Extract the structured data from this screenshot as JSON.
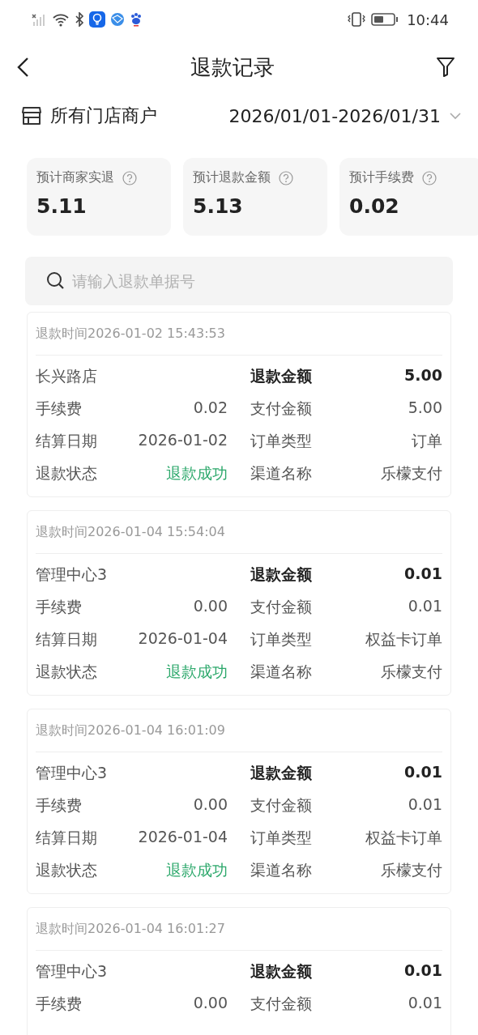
{
  "status_bar": {
    "time": "10:44"
  },
  "header": {
    "title": "退款记录"
  },
  "filter": {
    "store": "所有门店商户",
    "date_range": "2026/01/01-2026/01/31"
  },
  "stats": [
    {
      "label": "预计商家实退",
      "value": "5.11"
    },
    {
      "label": "预计退款金额",
      "value": "5.13"
    },
    {
      "label": "预计手续费",
      "value": "0.02"
    }
  ],
  "search": {
    "placeholder": "请输入退款单据号"
  },
  "records": [
    {
      "time": "退款时间2026-01-02 15:43:53",
      "rows": [
        {
          "kind": "head",
          "left_label": "长兴路店",
          "right_label": "退款金额",
          "right_value": "5.00"
        },
        {
          "kind": "plain",
          "left_label": "手续费",
          "left_value": "0.02",
          "right_label": "支付金额",
          "right_value": "5.00"
        },
        {
          "kind": "plain",
          "left_label": "结算日期",
          "left_value": "2026-01-02",
          "right_label": "订单类型",
          "right_value": "订单"
        },
        {
          "kind": "status",
          "left_label": "退款状态",
          "left_value": "退款成功",
          "right_label": "渠道名称",
          "right_value": "乐檬支付"
        }
      ]
    },
    {
      "time": "退款时间2026-01-04 15:54:04",
      "rows": [
        {
          "kind": "head",
          "left_label": "管理中心3",
          "right_label": "退款金额",
          "right_value": "0.01"
        },
        {
          "kind": "plain",
          "left_label": "手续费",
          "left_value": "0.00",
          "right_label": "支付金额",
          "right_value": "0.01"
        },
        {
          "kind": "plain",
          "left_label": "结算日期",
          "left_value": "2026-01-04",
          "right_label": "订单类型",
          "right_value": "权益卡订单"
        },
        {
          "kind": "status",
          "left_label": "退款状态",
          "left_value": "退款成功",
          "right_label": "渠道名称",
          "right_value": "乐檬支付"
        }
      ]
    },
    {
      "time": "退款时间2026-01-04 16:01:09",
      "rows": [
        {
          "kind": "head",
          "left_label": "管理中心3",
          "right_label": "退款金额",
          "right_value": "0.01"
        },
        {
          "kind": "plain",
          "left_label": "手续费",
          "left_value": "0.00",
          "right_label": "支付金额",
          "right_value": "0.01"
        },
        {
          "kind": "plain",
          "left_label": "结算日期",
          "left_value": "2026-01-04",
          "right_label": "订单类型",
          "right_value": "权益卡订单"
        },
        {
          "kind": "status",
          "left_label": "退款状态",
          "left_value": "退款成功",
          "right_label": "渠道名称",
          "right_value": "乐檬支付"
        }
      ]
    },
    {
      "time": "退款时间2026-01-04 16:01:27",
      "rows": [
        {
          "kind": "head",
          "left_label": "管理中心3",
          "right_label": "退款金额",
          "right_value": "0.01"
        },
        {
          "kind": "plain",
          "left_label": "手续费",
          "left_value": "0.00",
          "right_label": "支付金额",
          "right_value": "0.01"
        }
      ]
    }
  ]
}
